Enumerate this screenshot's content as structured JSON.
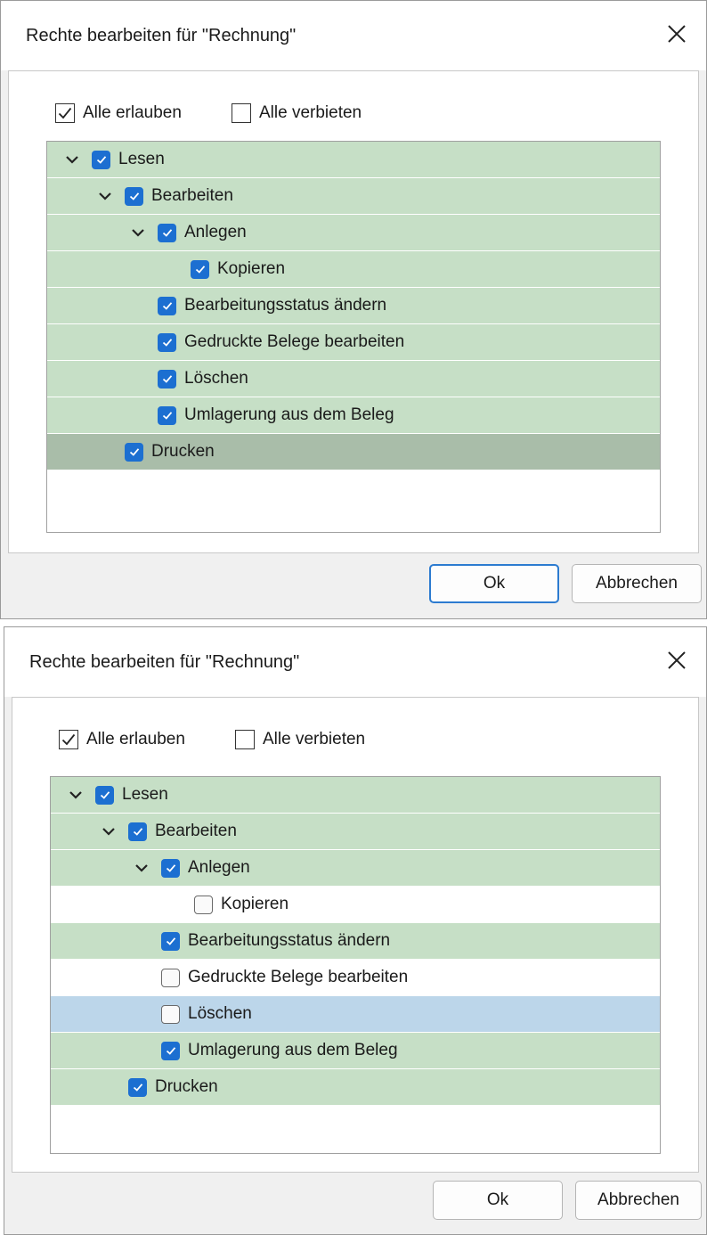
{
  "dialogs": [
    {
      "title": "Rechte bearbeiten für \"Rechnung\"",
      "allow_all": {
        "label": "Alle erlauben",
        "checked": true
      },
      "deny_all": {
        "label": "Alle verbieten",
        "checked": false
      },
      "tree": [
        {
          "label": "Lesen",
          "level": 0,
          "expandable": true,
          "checked": true,
          "state": "on"
        },
        {
          "label": "Bearbeiten",
          "level": 1,
          "expandable": true,
          "checked": true,
          "state": "on"
        },
        {
          "label": "Anlegen",
          "level": 2,
          "expandable": true,
          "checked": true,
          "state": "on"
        },
        {
          "label": "Kopieren",
          "level": 3,
          "expandable": false,
          "checked": true,
          "state": "on"
        },
        {
          "label": "Bearbeitungsstatus ändern",
          "level": 2,
          "expandable": false,
          "checked": true,
          "state": "on"
        },
        {
          "label": "Gedruckte Belege bearbeiten",
          "level": 2,
          "expandable": false,
          "checked": true,
          "state": "on"
        },
        {
          "label": "Löschen",
          "level": 2,
          "expandable": false,
          "checked": true,
          "state": "on"
        },
        {
          "label": "Umlagerung aus dem Beleg",
          "level": 2,
          "expandable": false,
          "checked": true,
          "state": "on"
        },
        {
          "label": "Drucken",
          "level": 1,
          "expandable": false,
          "checked": true,
          "state": "on-sel"
        }
      ],
      "ok_label": "Ok",
      "cancel_label": "Abbrechen"
    },
    {
      "title": "Rechte bearbeiten für \"Rechnung\"",
      "allow_all": {
        "label": "Alle erlauben",
        "checked": true
      },
      "deny_all": {
        "label": "Alle verbieten",
        "checked": false
      },
      "tree": [
        {
          "label": "Lesen",
          "level": 0,
          "expandable": true,
          "checked": true,
          "state": "on"
        },
        {
          "label": "Bearbeiten",
          "level": 1,
          "expandable": true,
          "checked": true,
          "state": "on"
        },
        {
          "label": "Anlegen",
          "level": 2,
          "expandable": true,
          "checked": true,
          "state": "on"
        },
        {
          "label": "Kopieren",
          "level": 3,
          "expandable": false,
          "checked": false,
          "state": "off"
        },
        {
          "label": "Bearbeitungsstatus ändern",
          "level": 2,
          "expandable": false,
          "checked": true,
          "state": "on"
        },
        {
          "label": "Gedruckte Belege bearbeiten",
          "level": 2,
          "expandable": false,
          "checked": false,
          "state": "off"
        },
        {
          "label": "Löschen",
          "level": 2,
          "expandable": false,
          "checked": false,
          "state": "hover"
        },
        {
          "label": "Umlagerung aus dem Beleg",
          "level": 2,
          "expandable": false,
          "checked": true,
          "state": "on"
        },
        {
          "label": "Drucken",
          "level": 1,
          "expandable": false,
          "checked": true,
          "state": "on"
        }
      ],
      "ok_label": "Ok",
      "cancel_label": "Abbrechen"
    }
  ],
  "colors": {
    "row_checked": "#c6dfc6",
    "row_selected": "#a9bda9",
    "row_hover": "#bcd6ea",
    "checkbox_blue": "#1c6fd1",
    "ok_border": "#2c7bd0"
  },
  "icons": {
    "close": "close-icon",
    "expand": "chevron-down-icon",
    "check": "checkmark-icon"
  }
}
